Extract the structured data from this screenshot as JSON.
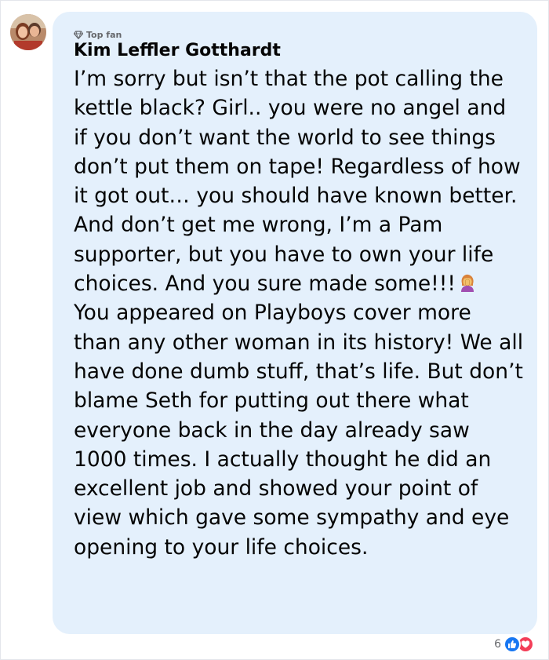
{
  "comment": {
    "badge": "Top fan",
    "author": "Kim Leffler Gotthardt",
    "text_before_emoji": "I’m sorry but isn’t that the pot calling the kettle black? Girl.. you were no angel and if you don’t want the world to see things don’t put them on tape! Regardless of how it got out… you should have known better. And don’t get me wrong, I’m a Pam supporter, but you have to own your life choices. And you sure made some!!!",
    "emoji": "woman-facepalming-icon",
    "text_after_emoji": "You appeared on Playboys cover more than any other woman in its history! We all have done dumb stuff, that’s life. But don’t blame Seth for putting out there what everyone back in the day already saw 1000 times. I actually thought he did an excellent job and showed your point of view which gave some sympathy and eye opening to your life choices."
  },
  "reactions": {
    "count": "6",
    "types": [
      "like-icon",
      "love-icon"
    ]
  },
  "colors": {
    "bubble": "#e4f0fc",
    "text": "#050505",
    "secondary_text": "#65676b",
    "like": "#1877f2",
    "love": "#f33e58"
  }
}
